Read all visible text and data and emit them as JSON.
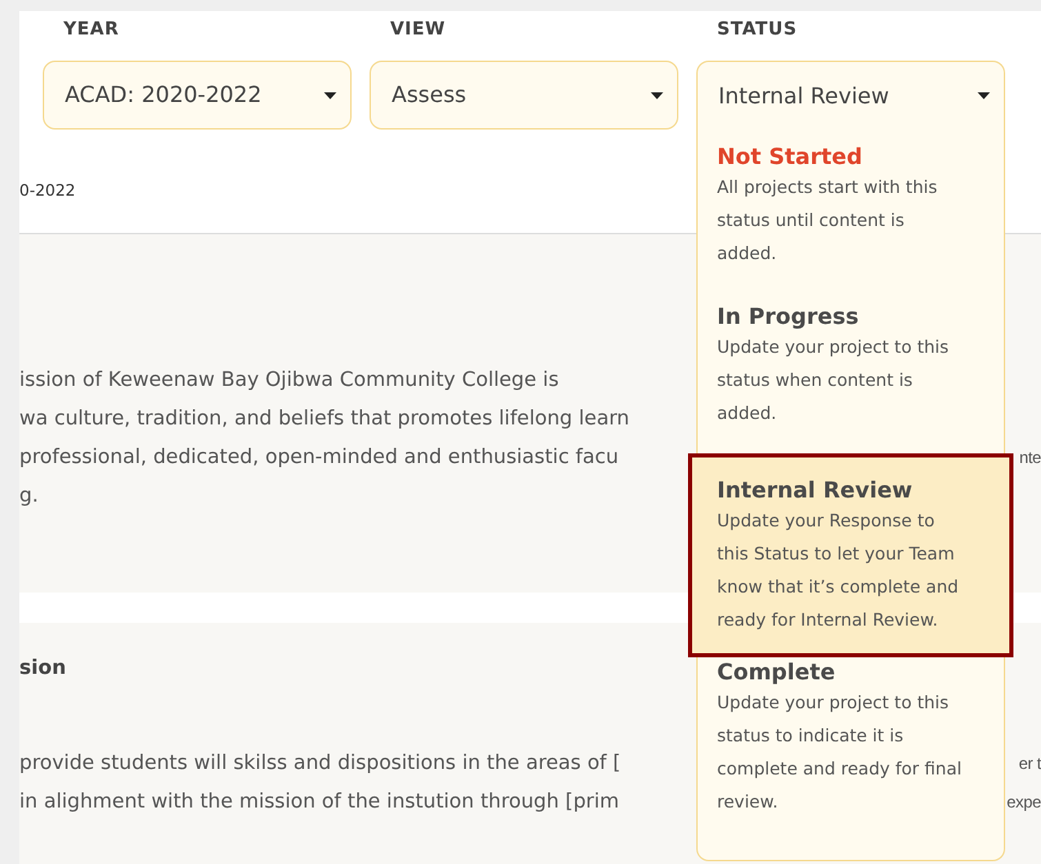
{
  "filters": [
    {
      "label": "YEAR",
      "value": "ACAD: 2020-2022",
      "expanded": false
    },
    {
      "label": "VIEW",
      "value": "Assess",
      "expanded": false
    },
    {
      "label": "STATUS",
      "value": "Internal Review",
      "expanded": true
    }
  ],
  "year_caption": "0-2022",
  "sections": [
    {
      "lines": [
        {
          "left": "ission of Keweenaw Bay Ojibwa Community College is"
        },
        {
          "left": "wa culture, tradition, and beliefs that promotes lifelong learn"
        },
        {
          "left": "professional, dedicated, open-minded and enthusiastic facu",
          "right": "nte"
        },
        {
          "left": "g."
        }
      ]
    },
    {
      "heading": "sion",
      "lines": [
        {
          "left": "provide students will skilss and dispositions in the areas of [",
          "right": "er t"
        },
        {
          "left": "in alighment with the mission of the instution through [prim",
          "right": "expe"
        }
      ]
    }
  ],
  "status_menu": [
    {
      "title": "Not Started",
      "description": "All projects start with this status until content is added.",
      "color": "#e0452b",
      "selected": false
    },
    {
      "title": "In Progress",
      "description": "Update your project to this status when content is added.",
      "color": "#4a4a4a",
      "selected": false
    },
    {
      "title": "Internal Review",
      "description": "Update your Response to this Status to let your Team know that it’s complete and ready for Internal Review.",
      "color": "#4a4a4a",
      "selected": true
    },
    {
      "title": "Complete",
      "description": "Update your project to this status to indicate it is complete and ready for final review.",
      "color": "#4a4a4a",
      "selected": false
    }
  ]
}
